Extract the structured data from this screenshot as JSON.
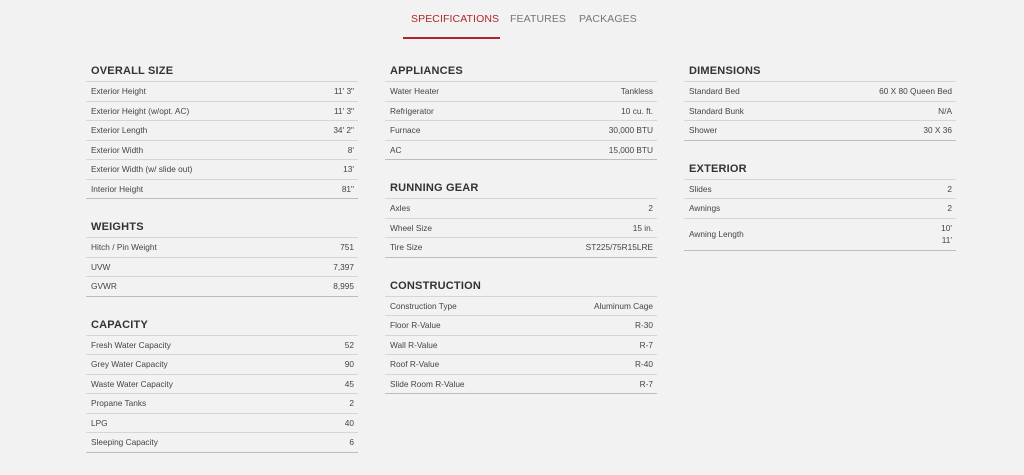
{
  "tabs": [
    {
      "label": "SPECIFICATIONS",
      "active": true
    },
    {
      "label": "FEATURES",
      "active": false
    },
    {
      "label": "PACKAGES",
      "active": false
    }
  ],
  "colors": {
    "accent": "#b0252d",
    "background": "#f2f2f2"
  },
  "columns": [
    [
      {
        "title": "OVERALL SIZE",
        "rows": [
          {
            "label": "Exterior Height",
            "value": "11' 3\""
          },
          {
            "label": "Exterior Height (w/opt. AC)",
            "value": "11' 3\""
          },
          {
            "label": "Exterior Length",
            "value": "34' 2\""
          },
          {
            "label": "Exterior Width",
            "value": "8'"
          },
          {
            "label": "Exterior Width (w/ slide out)",
            "value": "13'"
          },
          {
            "label": "Interior Height",
            "value": "81\""
          }
        ]
      },
      {
        "title": "WEIGHTS",
        "rows": [
          {
            "label": "Hitch / Pin Weight",
            "value": "751"
          },
          {
            "label": "UVW",
            "value": "7,397"
          },
          {
            "label": "GVWR",
            "value": "8,995"
          }
        ]
      },
      {
        "title": "CAPACITY",
        "rows": [
          {
            "label": "Fresh Water Capacity",
            "value": "52"
          },
          {
            "label": "Grey Water Capacity",
            "value": "90"
          },
          {
            "label": "Waste Water Capacity",
            "value": "45"
          },
          {
            "label": "Propane Tanks",
            "value": "2"
          },
          {
            "label": "LPG",
            "value": "40"
          },
          {
            "label": "Sleeping Capacity",
            "value": "6"
          }
        ]
      }
    ],
    [
      {
        "title": "APPLIANCES",
        "rows": [
          {
            "label": "Water Heater",
            "value": "Tankless"
          },
          {
            "label": "Refrigerator",
            "value": "10 cu. ft."
          },
          {
            "label": "Furnace",
            "value": "30,000 BTU"
          },
          {
            "label": "AC",
            "value": "15,000 BTU"
          }
        ]
      },
      {
        "title": "RUNNING GEAR",
        "rows": [
          {
            "label": "Axles",
            "value": "2"
          },
          {
            "label": "Wheel Size",
            "value": "15 in."
          },
          {
            "label": "Tire Size",
            "value": "ST225/75R15LRE"
          }
        ]
      },
      {
        "title": "CONSTRUCTION",
        "rows": [
          {
            "label": "Construction Type",
            "value": "Aluminum Cage"
          },
          {
            "label": "Floor R-Value",
            "value": "R-30"
          },
          {
            "label": "Wall R-Value",
            "value": "R-7"
          },
          {
            "label": "Roof R-Value",
            "value": "R-40"
          },
          {
            "label": "Slide Room R-Value",
            "value": "R-7"
          }
        ]
      }
    ],
    [
      {
        "title": "DIMENSIONS",
        "rows": [
          {
            "label": "Standard Bed",
            "value": "60 X 80 Queen Bed"
          },
          {
            "label": "Standard Bunk",
            "value": "N/A"
          },
          {
            "label": "Shower",
            "value": "30 X 36"
          }
        ]
      },
      {
        "title": "EXTERIOR",
        "rows": [
          {
            "label": "Slides",
            "value": "2"
          },
          {
            "label": "Awnings",
            "value": "2"
          },
          {
            "label": "Awning Length",
            "value": "10'",
            "value2": "11'"
          }
        ]
      }
    ]
  ]
}
